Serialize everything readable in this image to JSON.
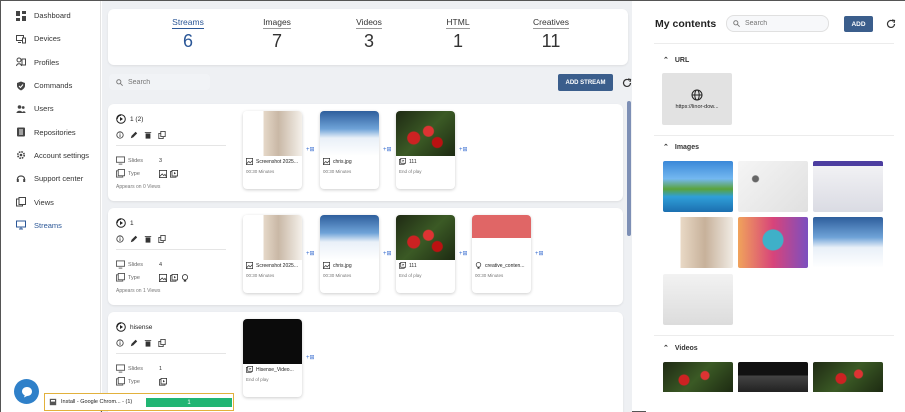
{
  "sidebar": {
    "items": [
      {
        "label": "Dashboard",
        "icon": "dashboard-icon"
      },
      {
        "label": "Devices",
        "icon": "devices-icon"
      },
      {
        "label": "Profiles",
        "icon": "profiles-icon"
      },
      {
        "label": "Commands",
        "icon": "shield-icon"
      },
      {
        "label": "Users",
        "icon": "users-icon"
      },
      {
        "label": "Repositories",
        "icon": "repository-icon"
      },
      {
        "label": "Account settings",
        "icon": "gear-icon"
      },
      {
        "label": "Support center",
        "icon": "headset-icon"
      },
      {
        "label": "Views",
        "icon": "views-icon"
      },
      {
        "label": "Streams",
        "icon": "monitor-icon"
      }
    ],
    "active": "Streams"
  },
  "stats": [
    {
      "label": "Streams",
      "value": "6"
    },
    {
      "label": "Images",
      "value": "7"
    },
    {
      "label": "Videos",
      "value": "3"
    },
    {
      "label": "HTML",
      "value": "1"
    },
    {
      "label": "Creatives",
      "value": "11"
    }
  ],
  "toolbar": {
    "search_placeholder": "Search",
    "add_stream_label": "ADD STREAM"
  },
  "streams": [
    {
      "name": "1 (2)",
      "slides_label": "Slides",
      "slides": "3",
      "type_label": "Type",
      "appears": "Appears on 0 Views",
      "tiles": [
        {
          "name": "Screenshot 2025...",
          "duration": "00:30 Minutes",
          "kind": "image"
        },
        {
          "name": "chris.jpg",
          "duration": "00:30 Minutes",
          "kind": "image"
        },
        {
          "name": "111",
          "duration": "End of play",
          "kind": "video"
        }
      ]
    },
    {
      "name": "1",
      "slides_label": "Slides",
      "slides": "4",
      "type_label": "Type",
      "appears": "Appears on 1 Views",
      "tiles": [
        {
          "name": "Screenshot 2025...",
          "duration": "00:30 Minutes",
          "kind": "image"
        },
        {
          "name": "chris.jpg",
          "duration": "00:30 Minutes",
          "kind": "image"
        },
        {
          "name": "111",
          "duration": "End of play",
          "kind": "video"
        },
        {
          "name": "creative_conten...",
          "duration": "00:30 Minutes",
          "kind": "creative"
        }
      ]
    },
    {
      "name": "hisense",
      "slides_label": "Slides",
      "slides": "1",
      "type_label": "Type",
      "appears": "",
      "tiles": [
        {
          "name": "Hisense_Video...",
          "duration": "End of play",
          "kind": "video"
        }
      ]
    }
  ],
  "tile_add_glyph": "+⊞",
  "contents": {
    "title": "My contents",
    "search_placeholder": "Search",
    "add_label": "ADD",
    "sections": {
      "url": {
        "label": "URL",
        "items": [
          {
            "label": "https://linor-dow..."
          }
        ]
      },
      "images": {
        "label": "Images"
      },
      "videos": {
        "label": "Videos"
      }
    }
  },
  "download": {
    "label": "Install - Google Chrom... - (1)",
    "progress_label": "1",
    "progress": 1.0
  },
  "colors": {
    "accent": "#2b5797",
    "button": "#3b5e8c",
    "progress": "#21b573",
    "link": "#3b6fd0"
  }
}
